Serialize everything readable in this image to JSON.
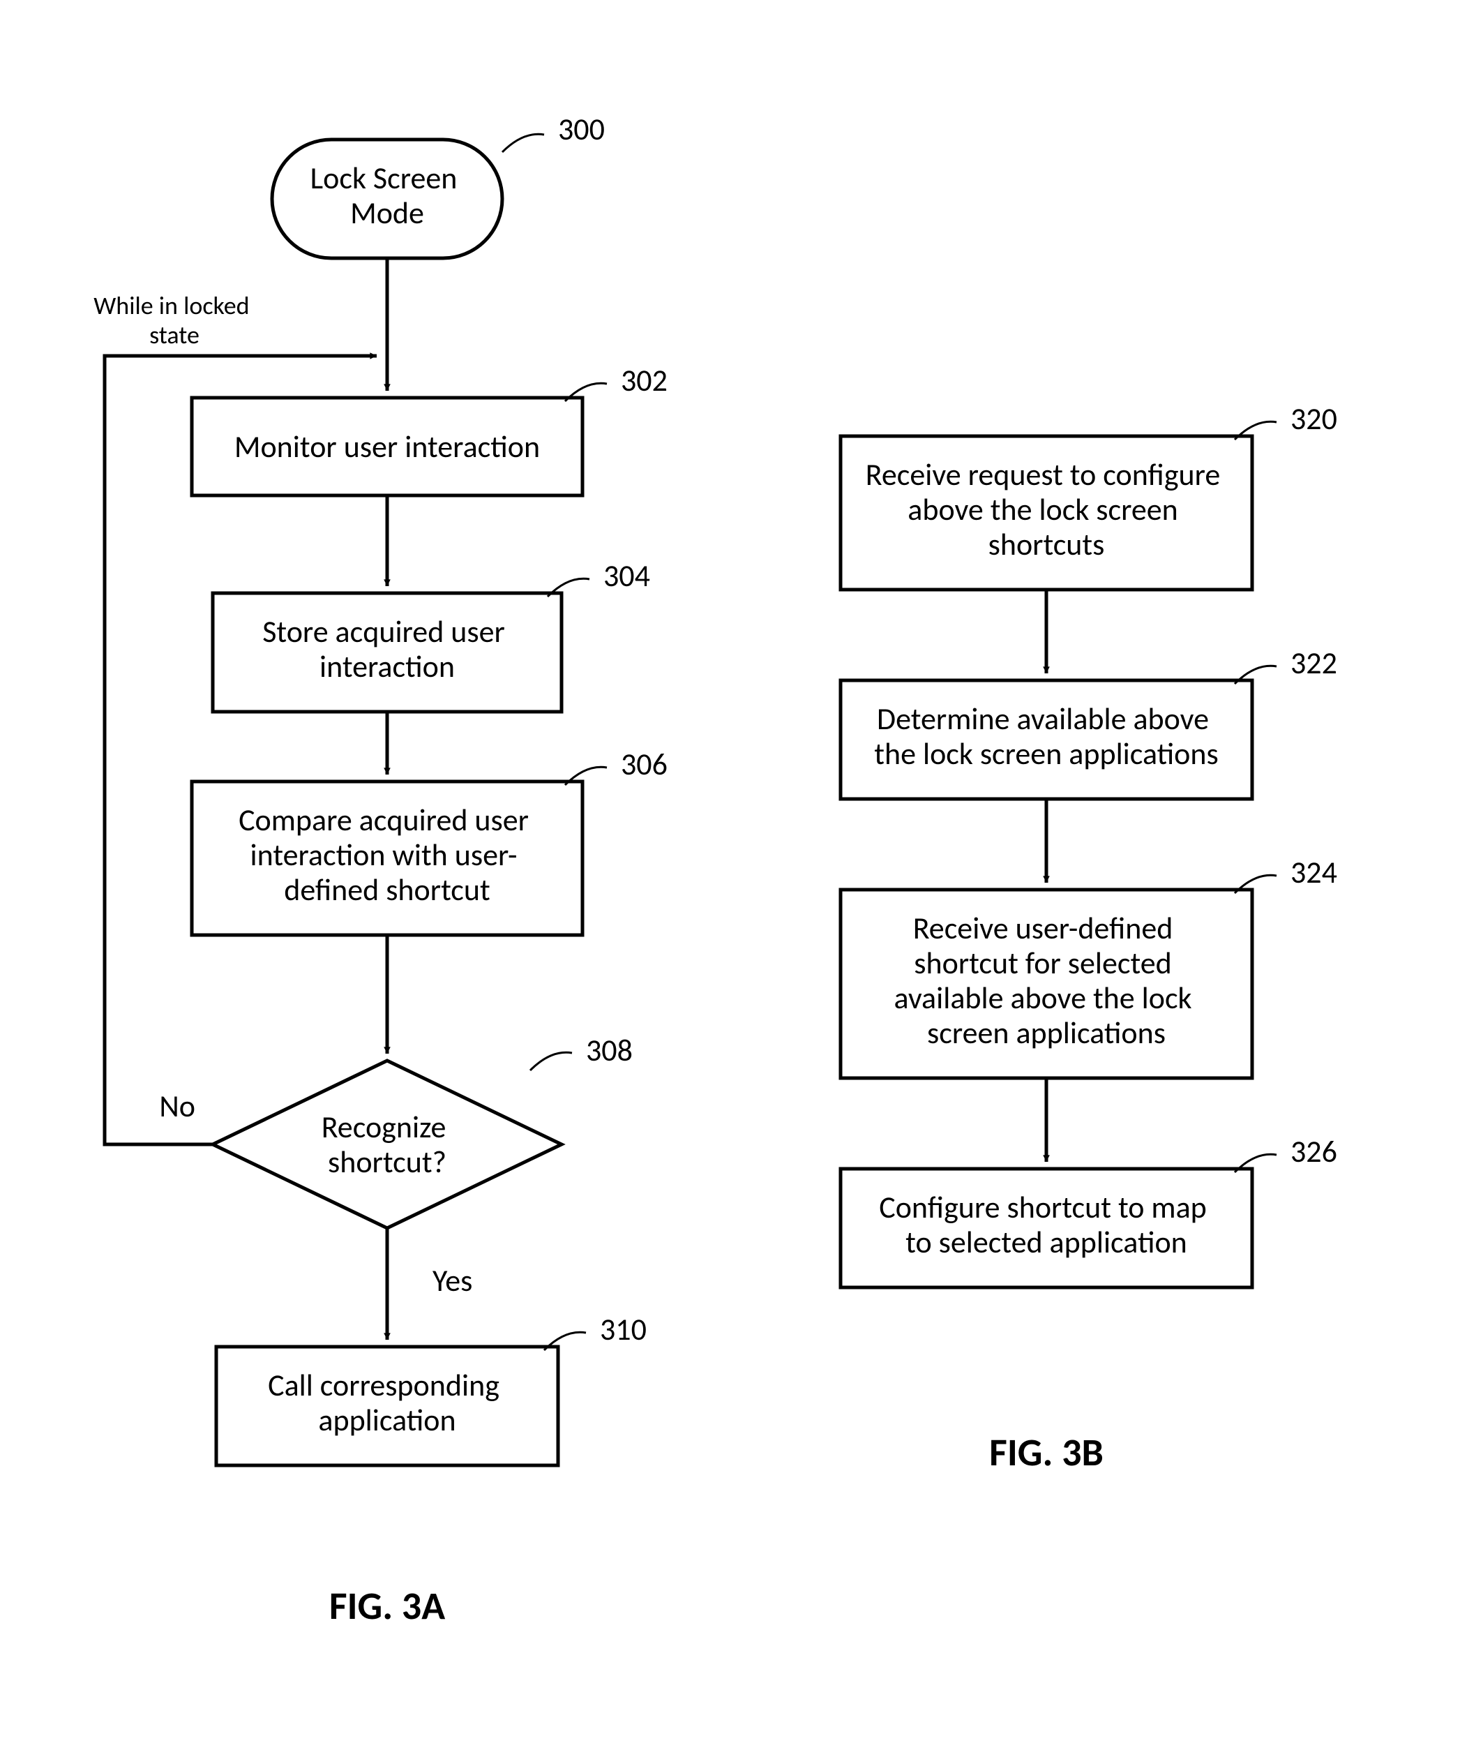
{
  "figA": {
    "caption": "FIG. 3A",
    "start": {
      "ref": "300",
      "text": "Lock Screen Mode"
    },
    "loop_label": "While in locked state",
    "steps": [
      {
        "ref": "302",
        "text": "Monitor user interaction"
      },
      {
        "ref": "304",
        "text": "Store acquired user interaction"
      },
      {
        "ref": "306",
        "text": "Compare acquired user interaction with user-defined shortcut"
      }
    ],
    "decision": {
      "ref": "308",
      "text": "Recognize shortcut?",
      "no": "No",
      "yes": "Yes"
    },
    "final": {
      "ref": "310",
      "text": "Call corresponding application"
    }
  },
  "figB": {
    "caption": "FIG. 3B",
    "steps": [
      {
        "ref": "320",
        "text": "Receive request to configure above the lock screen shortcuts"
      },
      {
        "ref": "322",
        "text": "Determine available above the lock screen applications"
      },
      {
        "ref": "324",
        "text": "Receive user-defined shortcut for selected available above the lock screen applications"
      },
      {
        "ref": "326",
        "text": "Configure shortcut to map to selected application"
      }
    ]
  }
}
